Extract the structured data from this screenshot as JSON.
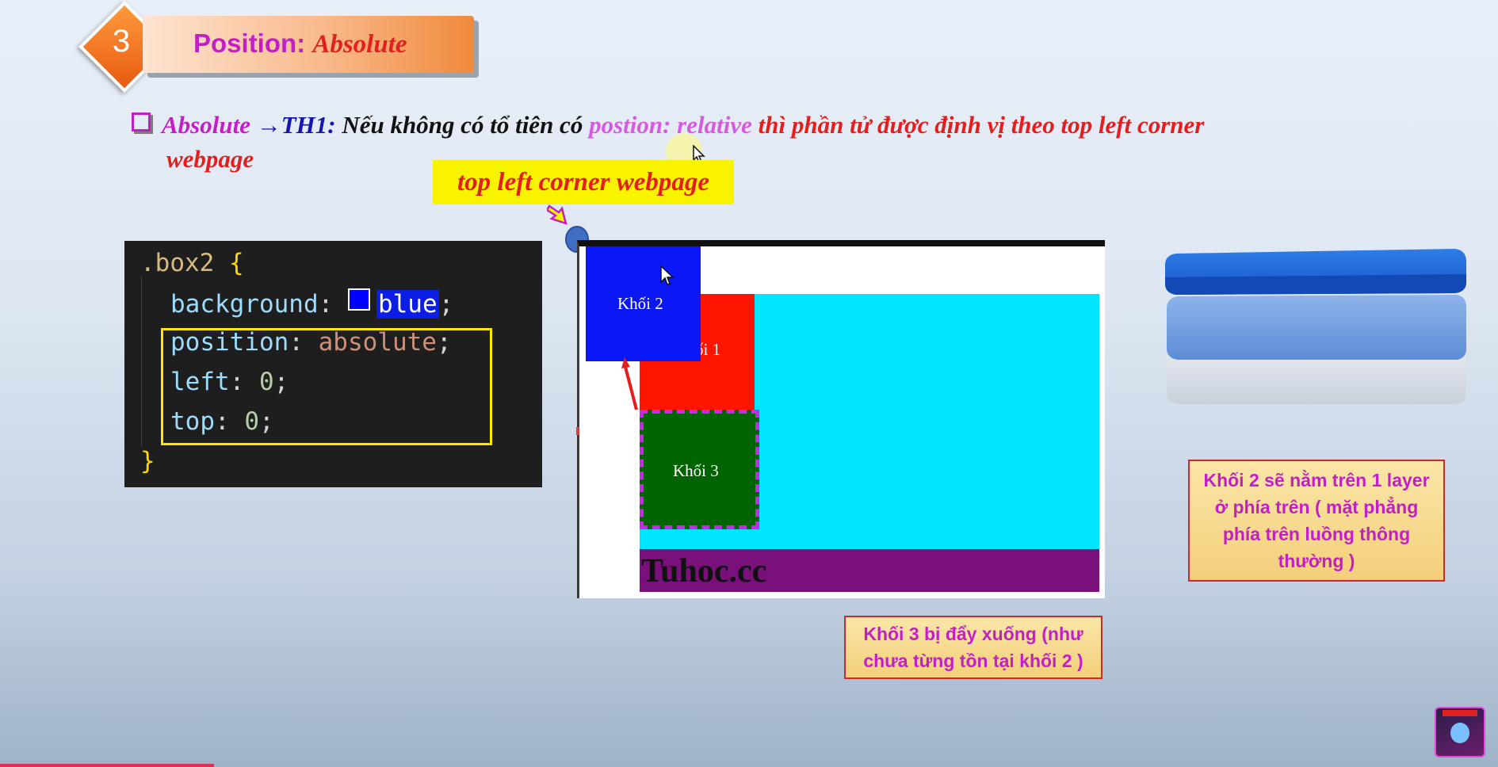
{
  "header": {
    "number": "3",
    "title_prefix": "Position: ",
    "title_emphasis": "Absolute"
  },
  "bullet": {
    "part_absolute": "Absolute",
    "arrow": "→",
    "part_th1": "TH1:",
    "part_text": "Nếu không có tổ tiên có",
    "part_postion": "postion: relative",
    "part_red": "thì phần tử được định vị theo top left corner",
    "part_line2": "webpage"
  },
  "callout": {
    "label": "top left corner webpage"
  },
  "code": {
    "selector": ".box2",
    "open_brace": "{",
    "close_brace": "}",
    "lines": [
      {
        "prop": "background",
        "value": "blue"
      },
      {
        "prop": "position",
        "value": "absolute"
      },
      {
        "prop": "left",
        "value": "0"
      },
      {
        "prop": "top",
        "value": "0"
      }
    ]
  },
  "demo": {
    "box1_label": "ối 1",
    "box2_label": "Khối 2",
    "box3_label": "Khối 3",
    "footer_text": "Tuhoc.cc"
  },
  "notes": {
    "right": "Khối 2 sẽ nằm trên 1 layer ở phía trên ( mặt phẳng phía trên luồng thông thường )",
    "bottom": "Khối 3 bị đẩy xuống (như chưa từng tồn tại khối 2 )"
  },
  "colors": {
    "accent_magenta": "#c21fc6",
    "accent_red": "#e41d1d",
    "badge_orange": "#e75a12",
    "callout_yellow": "#f8f400",
    "box1": "#ff1500",
    "box2": "#0b17f5",
    "box3": "#006400",
    "cyan": "#00e5ff",
    "footer": "#7a1079"
  },
  "icons": [
    "checkbox-bullet-icon",
    "arrow-right-icon",
    "pointer-arrow-icon",
    "mouse-cursor-icon",
    "stacked-layers-icon",
    "channel-avatar-icon"
  ]
}
